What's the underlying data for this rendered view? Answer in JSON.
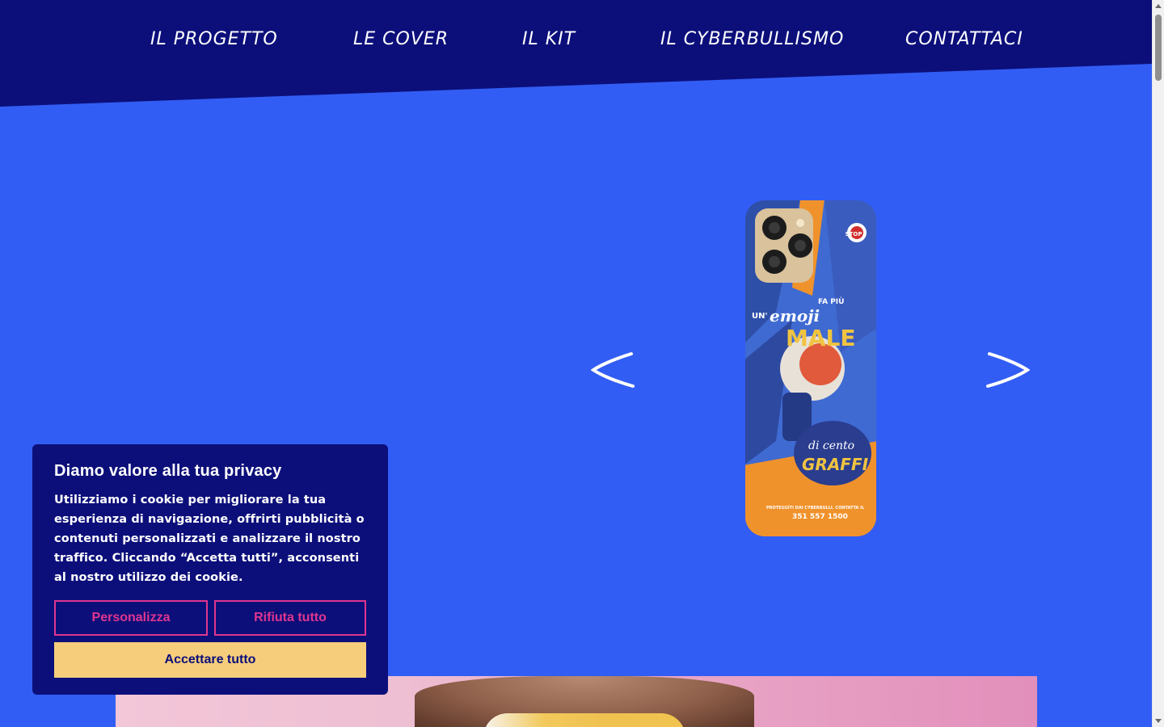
{
  "nav": {
    "items": [
      {
        "label": "IL PROGETTO"
      },
      {
        "label": "LE COVER"
      },
      {
        "label": "IL KIT"
      },
      {
        "label": "IL CYBERBULLISMO"
      },
      {
        "label": "CONTATTACI"
      }
    ]
  },
  "colors": {
    "header_bg": "#0c0f7a",
    "page_bg": "#325df4",
    "accent_pink": "#e0358f",
    "accent_yellow": "#f6cd7a"
  },
  "carousel": {
    "prev_icon": "chevron-left-icon",
    "next_icon": "chevron-right-icon"
  },
  "phone_case": {
    "line1": "UN'",
    "line2": "emoji",
    "line3": "FA PIÙ",
    "line4": "MALE",
    "line5": "di cento",
    "line6": "GRAFFI",
    "footer": "PROTEGGITI DAI CYBERBULLI. CONTATTA IL",
    "phone": "351 557 1500",
    "badge": "STOP"
  },
  "cookie": {
    "title": "Diamo valore alla tua privacy",
    "text": "Utilizziamo i cookie per migliorare la tua esperienza di navigazione, offrirti pubblicità o contenuti personalizzati e analizzare il nostro traffico. Cliccando “Accetta tutti”, acconsenti al nostro utilizzo dei cookie.",
    "customize_label": "Personalizza",
    "reject_label": "Rifiuta tutto",
    "accept_label": "Accettare tutto"
  }
}
